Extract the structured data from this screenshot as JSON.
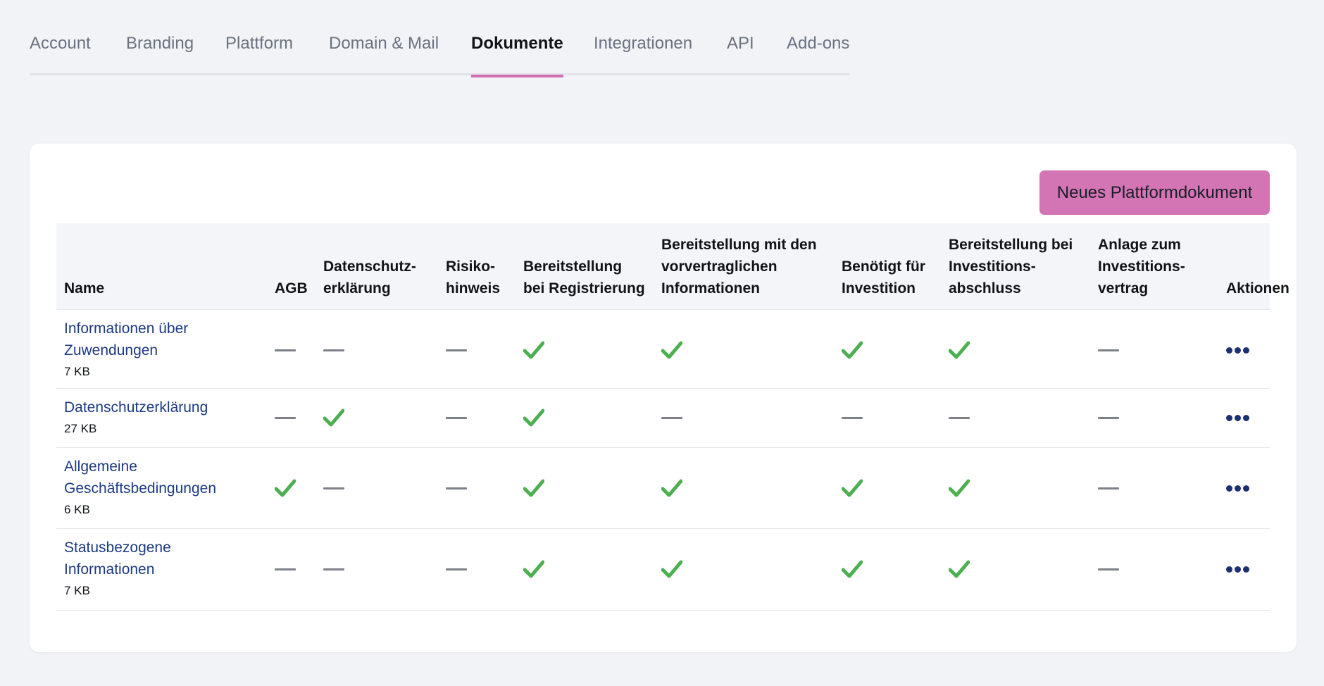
{
  "tabs": [
    {
      "label": "Account",
      "active": false
    },
    {
      "label": "Branding",
      "active": false
    },
    {
      "label": "Plattform",
      "active": false
    },
    {
      "label": "Domain & Mail",
      "active": false
    },
    {
      "label": "Dokumente",
      "active": true
    },
    {
      "label": "Integrationen",
      "active": false
    },
    {
      "label": "API",
      "active": false
    },
    {
      "label": "Add-ons",
      "active": false
    }
  ],
  "new_document_button": "Neues Plattformdokument",
  "table": {
    "headers": [
      [
        "Name"
      ],
      [
        "AGB"
      ],
      [
        "Datenschutz-",
        "erklärung"
      ],
      [
        "Risiko-",
        "hinweis"
      ],
      [
        "Bereitstellung",
        "bei Registrierung"
      ],
      [
        "Bereitstellung mit den",
        "vorvertraglichen",
        "Informationen"
      ],
      [
        "Benötigt für",
        "Investition"
      ],
      [
        "Bereitstellung bei",
        "Investitions-",
        "abschluss"
      ],
      [
        "Anlage zum",
        "Investitions-",
        "vertrag"
      ],
      [
        "Aktionen"
      ]
    ],
    "rows": [
      {
        "name": [
          "Informationen über",
          "Zuwendungen"
        ],
        "size": "7 KB",
        "flags": [
          false,
          false,
          false,
          true,
          true,
          true,
          true,
          false
        ]
      },
      {
        "name": [
          "Datenschutzerklärung"
        ],
        "size": "27 KB",
        "flags": [
          false,
          true,
          false,
          true,
          false,
          false,
          false,
          false
        ]
      },
      {
        "name": [
          "Allgemeine",
          "Geschäftsbedingungen"
        ],
        "size": "6 KB",
        "flags": [
          true,
          false,
          false,
          true,
          true,
          true,
          true,
          false
        ]
      },
      {
        "name": [
          "Statusbezogene",
          "Informationen"
        ],
        "size": "7 KB",
        "flags": [
          false,
          false,
          false,
          true,
          true,
          true,
          true,
          false
        ]
      }
    ]
  },
  "icons": {
    "check": "check-icon",
    "dash": "dash-icon",
    "more": "more-actions-icon"
  },
  "colors": {
    "accent": "#d374b5",
    "check": "#4caf50",
    "link": "#1c3a80",
    "dash": "#7d8089"
  }
}
